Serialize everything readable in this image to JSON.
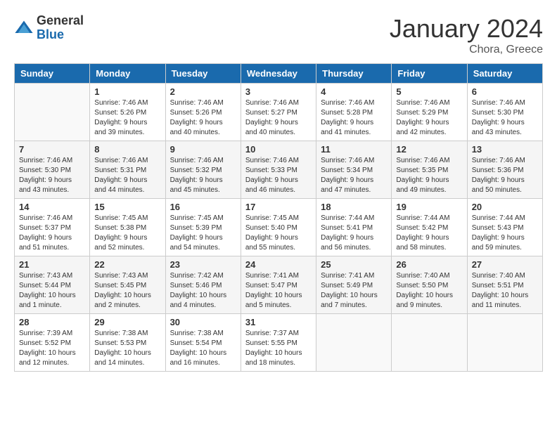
{
  "logo": {
    "general": "General",
    "blue": "Blue"
  },
  "title": "January 2024",
  "subtitle": "Chora, Greece",
  "days_header": [
    "Sunday",
    "Monday",
    "Tuesday",
    "Wednesday",
    "Thursday",
    "Friday",
    "Saturday"
  ],
  "weeks": [
    [
      {
        "day": "",
        "info": ""
      },
      {
        "day": "1",
        "info": "Sunrise: 7:46 AM\nSunset: 5:26 PM\nDaylight: 9 hours\nand 39 minutes."
      },
      {
        "day": "2",
        "info": "Sunrise: 7:46 AM\nSunset: 5:26 PM\nDaylight: 9 hours\nand 40 minutes."
      },
      {
        "day": "3",
        "info": "Sunrise: 7:46 AM\nSunset: 5:27 PM\nDaylight: 9 hours\nand 40 minutes."
      },
      {
        "day": "4",
        "info": "Sunrise: 7:46 AM\nSunset: 5:28 PM\nDaylight: 9 hours\nand 41 minutes."
      },
      {
        "day": "5",
        "info": "Sunrise: 7:46 AM\nSunset: 5:29 PM\nDaylight: 9 hours\nand 42 minutes."
      },
      {
        "day": "6",
        "info": "Sunrise: 7:46 AM\nSunset: 5:30 PM\nDaylight: 9 hours\nand 43 minutes."
      }
    ],
    [
      {
        "day": "7",
        "info": "Sunrise: 7:46 AM\nSunset: 5:30 PM\nDaylight: 9 hours\nand 43 minutes."
      },
      {
        "day": "8",
        "info": "Sunrise: 7:46 AM\nSunset: 5:31 PM\nDaylight: 9 hours\nand 44 minutes."
      },
      {
        "day": "9",
        "info": "Sunrise: 7:46 AM\nSunset: 5:32 PM\nDaylight: 9 hours\nand 45 minutes."
      },
      {
        "day": "10",
        "info": "Sunrise: 7:46 AM\nSunset: 5:33 PM\nDaylight: 9 hours\nand 46 minutes."
      },
      {
        "day": "11",
        "info": "Sunrise: 7:46 AM\nSunset: 5:34 PM\nDaylight: 9 hours\nand 47 minutes."
      },
      {
        "day": "12",
        "info": "Sunrise: 7:46 AM\nSunset: 5:35 PM\nDaylight: 9 hours\nand 49 minutes."
      },
      {
        "day": "13",
        "info": "Sunrise: 7:46 AM\nSunset: 5:36 PM\nDaylight: 9 hours\nand 50 minutes."
      }
    ],
    [
      {
        "day": "14",
        "info": "Sunrise: 7:46 AM\nSunset: 5:37 PM\nDaylight: 9 hours\nand 51 minutes."
      },
      {
        "day": "15",
        "info": "Sunrise: 7:45 AM\nSunset: 5:38 PM\nDaylight: 9 hours\nand 52 minutes."
      },
      {
        "day": "16",
        "info": "Sunrise: 7:45 AM\nSunset: 5:39 PM\nDaylight: 9 hours\nand 54 minutes."
      },
      {
        "day": "17",
        "info": "Sunrise: 7:45 AM\nSunset: 5:40 PM\nDaylight: 9 hours\nand 55 minutes."
      },
      {
        "day": "18",
        "info": "Sunrise: 7:44 AM\nSunset: 5:41 PM\nDaylight: 9 hours\nand 56 minutes."
      },
      {
        "day": "19",
        "info": "Sunrise: 7:44 AM\nSunset: 5:42 PM\nDaylight: 9 hours\nand 58 minutes."
      },
      {
        "day": "20",
        "info": "Sunrise: 7:44 AM\nSunset: 5:43 PM\nDaylight: 9 hours\nand 59 minutes."
      }
    ],
    [
      {
        "day": "21",
        "info": "Sunrise: 7:43 AM\nSunset: 5:44 PM\nDaylight: 10 hours\nand 1 minute."
      },
      {
        "day": "22",
        "info": "Sunrise: 7:43 AM\nSunset: 5:45 PM\nDaylight: 10 hours\nand 2 minutes."
      },
      {
        "day": "23",
        "info": "Sunrise: 7:42 AM\nSunset: 5:46 PM\nDaylight: 10 hours\nand 4 minutes."
      },
      {
        "day": "24",
        "info": "Sunrise: 7:41 AM\nSunset: 5:47 PM\nDaylight: 10 hours\nand 5 minutes."
      },
      {
        "day": "25",
        "info": "Sunrise: 7:41 AM\nSunset: 5:49 PM\nDaylight: 10 hours\nand 7 minutes."
      },
      {
        "day": "26",
        "info": "Sunrise: 7:40 AM\nSunset: 5:50 PM\nDaylight: 10 hours\nand 9 minutes."
      },
      {
        "day": "27",
        "info": "Sunrise: 7:40 AM\nSunset: 5:51 PM\nDaylight: 10 hours\nand 11 minutes."
      }
    ],
    [
      {
        "day": "28",
        "info": "Sunrise: 7:39 AM\nSunset: 5:52 PM\nDaylight: 10 hours\nand 12 minutes."
      },
      {
        "day": "29",
        "info": "Sunrise: 7:38 AM\nSunset: 5:53 PM\nDaylight: 10 hours\nand 14 minutes."
      },
      {
        "day": "30",
        "info": "Sunrise: 7:38 AM\nSunset: 5:54 PM\nDaylight: 10 hours\nand 16 minutes."
      },
      {
        "day": "31",
        "info": "Sunrise: 7:37 AM\nSunset: 5:55 PM\nDaylight: 10 hours\nand 18 minutes."
      },
      {
        "day": "",
        "info": ""
      },
      {
        "day": "",
        "info": ""
      },
      {
        "day": "",
        "info": ""
      }
    ]
  ]
}
